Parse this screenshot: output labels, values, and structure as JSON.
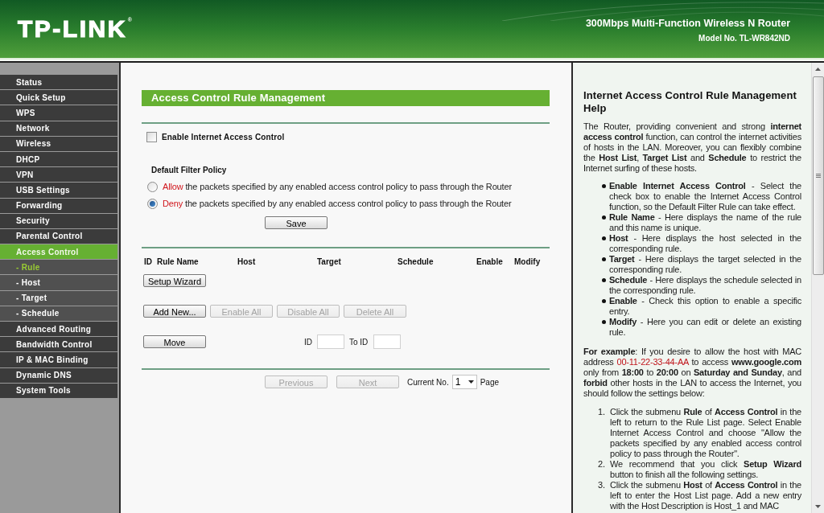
{
  "header": {
    "logo": "TP-LINK",
    "logo_mark": "®",
    "product": "300Mbps Multi-Function Wireless N Router",
    "model": "Model No. TL-WR842ND"
  },
  "sidebar": {
    "items": [
      {
        "label": "Status",
        "selected": false
      },
      {
        "label": "Quick Setup",
        "selected": false
      },
      {
        "label": "WPS",
        "selected": false
      },
      {
        "label": "Network",
        "selected": false
      },
      {
        "label": "Wireless",
        "selected": false
      },
      {
        "label": "DHCP",
        "selected": false
      },
      {
        "label": "VPN",
        "selected": false
      },
      {
        "label": "USB Settings",
        "selected": false
      },
      {
        "label": "Forwarding",
        "selected": false
      },
      {
        "label": "Security",
        "selected": false
      },
      {
        "label": "Parental Control",
        "selected": false
      },
      {
        "label": "Access Control",
        "selected": true,
        "children": [
          {
            "label": "- Rule",
            "selected": true
          },
          {
            "label": "- Host",
            "selected": false
          },
          {
            "label": "- Target",
            "selected": false
          },
          {
            "label": "- Schedule",
            "selected": false
          }
        ]
      },
      {
        "label": "Advanced Routing",
        "selected": false
      },
      {
        "label": "Bandwidth Control",
        "selected": false
      },
      {
        "label": "IP & MAC Binding",
        "selected": false
      },
      {
        "label": "Dynamic DNS",
        "selected": false
      },
      {
        "label": "System Tools",
        "selected": false
      }
    ]
  },
  "main": {
    "title": "Access Control Rule Management",
    "enable_control": {
      "label": "Enable Internet Access Control",
      "checked": false
    },
    "policy": {
      "heading": "Default Filter Policy",
      "options": [
        {
          "keyword": "Allow",
          "text": "the packets specified by any enabled access control policy to pass through the Router",
          "selected": false
        },
        {
          "keyword": "Deny",
          "text": "the packets specified by any enabled access control policy to pass through the Router",
          "selected": true
        }
      ]
    },
    "save_button": "Save",
    "table": {
      "columns": [
        "ID",
        "Rule Name",
        "Host",
        "Target",
        "Schedule",
        "Enable",
        "Modify"
      ]
    },
    "setup_wizard_button": "Setup Wizard",
    "action_buttons": [
      {
        "label": "Add New...",
        "disabled": false
      },
      {
        "label": "Enable All",
        "disabled": true
      },
      {
        "label": "Disable All",
        "disabled": true
      },
      {
        "label": "Delete All",
        "disabled": true
      }
    ],
    "move": {
      "button": "Move",
      "id_label": "ID",
      "to_id_label": "To ID"
    },
    "pager": {
      "buttons": [
        {
          "label": "Previous",
          "disabled": true
        },
        {
          "label": "Next",
          "disabled": true
        }
      ],
      "current_label": "Current No.",
      "page_value": "1",
      "page_label": "Page"
    }
  },
  "help": {
    "title": "Internet Access Control Rule Management Help",
    "intro": "The Router, providing convenient and strong **internet access control** function, can control the internet activities of hosts in the LAN. Moreover, you can flexibly combine the **Host List**, **Target List** and **Schedule** to restrict the Internet surfing of these hosts.",
    "bullets": [
      "**Enable Internet Access Control** - Select the check box to enable the Internet Access Control function, so the Default Filter Rule can take effect.",
      "**Rule Name** - Here displays the name of the rule and this name is unique.",
      "**Host** - Here displays the host selected in the corresponding rule.",
      "**Target** - Here displays the target selected in the corresponding rule.",
      "**Schedule** - Here displays the schedule selected in the corresponding rule.",
      "**Enable** - Check this option to enable a specific entry.",
      "**Modify** - Here you can edit or delete an existing rule."
    ],
    "example": {
      "before": "**For example**: If you desire to allow the host with MAC address",
      "mac": "00-11-22-33-44-AA",
      "after": "to access **www.google.com** only from **18:00** to **20:00** on **Saturday and Sunday**, and **forbid** other hosts in the LAN to access the Internet, you should follow the settings below:"
    },
    "steps": [
      {
        "number": "1.",
        "text": "Click the submenu **Rule** of **Access Control** in the left to return to the Rule List page. Select Enable Internet Access Control and choose \"Allow the packets specified by any enabled access control policy to pass through the Router\"."
      },
      {
        "number": "2.",
        "text": "We recommend that you click **Setup Wizard** button to finish all the following settings."
      },
      {
        "number": "3.",
        "text": "Click the submenu **Host** of **Access Control** in the left to enter the Host List page. Add a new entry with the Host Description is Host_1 and MAC"
      }
    ]
  }
}
